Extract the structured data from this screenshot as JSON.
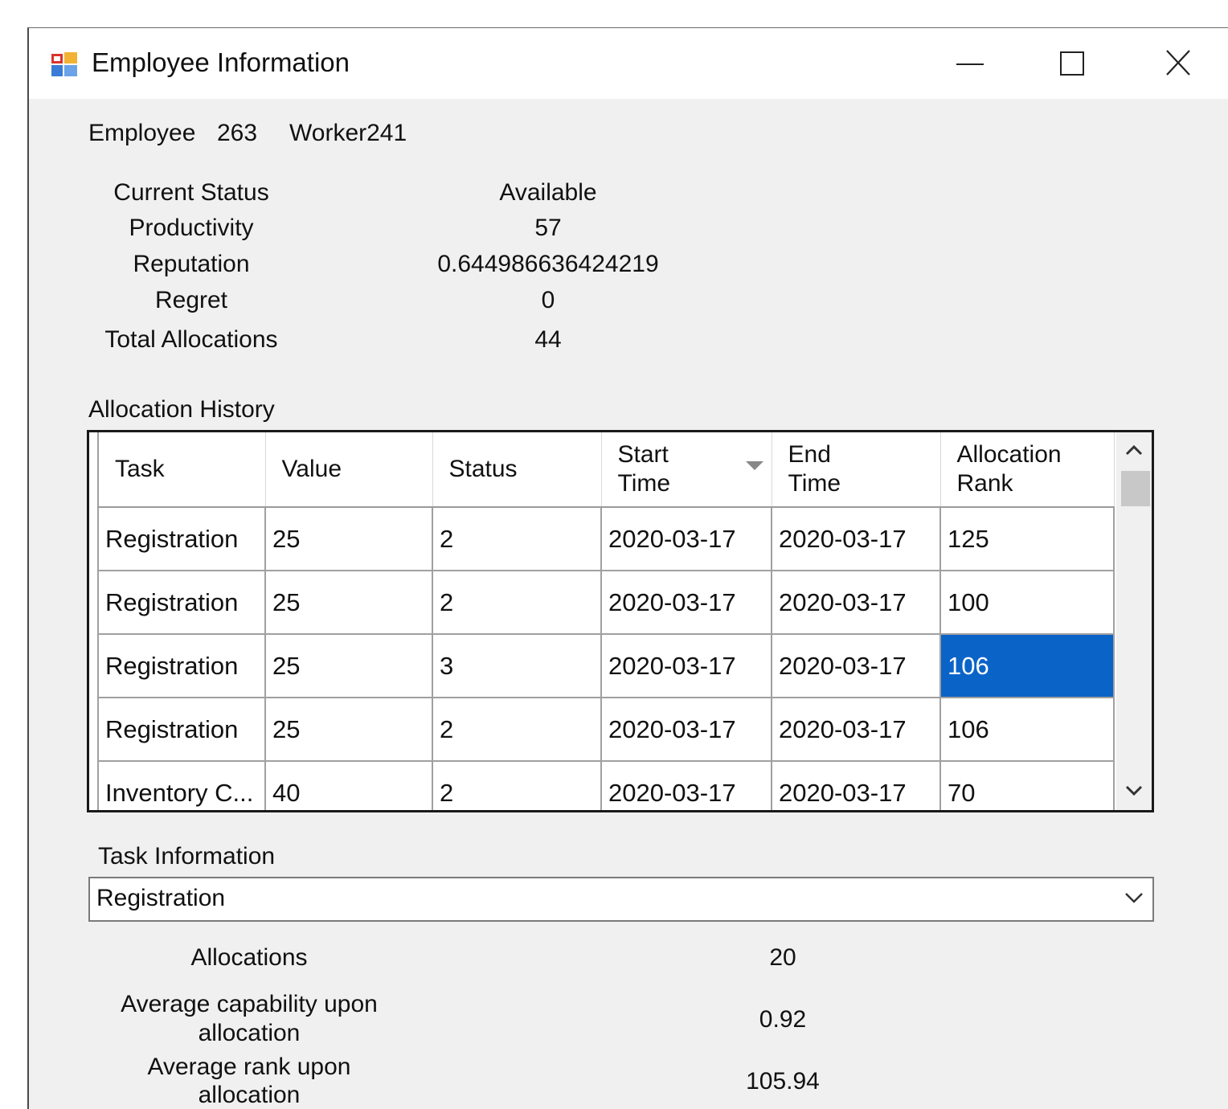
{
  "window": {
    "title": "Employee Information",
    "controls": [
      "minimize",
      "maximize",
      "close"
    ]
  },
  "employee": {
    "label": "Employee",
    "id": "263",
    "name": "Worker241"
  },
  "stats": {
    "current_status": {
      "label": "Current Status",
      "value": "Available"
    },
    "productivity": {
      "label": "Productivity",
      "value": "57"
    },
    "reputation": {
      "label": "Reputation",
      "value": "0.644986636424219"
    },
    "regret": {
      "label": "Regret",
      "value": "0"
    },
    "total_allocations": {
      "label": "Total Allocations",
      "value": "44"
    }
  },
  "allocation_history": {
    "label": "Allocation History",
    "columns": {
      "task": "Task",
      "value": "Value",
      "status": "Status",
      "start_time": "Start Time",
      "end_time": "End Time",
      "allocation_rank": "Allocation Rank"
    },
    "rows": [
      {
        "task": "Registration",
        "value": "25",
        "status": "2",
        "start": "2020-03-17",
        "end": "2020-03-17",
        "rank": "125"
      },
      {
        "task": "Registration",
        "value": "25",
        "status": "2",
        "start": "2020-03-17",
        "end": "2020-03-17",
        "rank": "100"
      },
      {
        "task": "Registration",
        "value": "25",
        "status": "3",
        "start": "2020-03-17",
        "end": "2020-03-17",
        "rank": "106"
      },
      {
        "task": "Registration",
        "value": "25",
        "status": "2",
        "start": "2020-03-17",
        "end": "2020-03-17",
        "rank": "106"
      },
      {
        "task": "Inventory C...",
        "value": "40",
        "status": "2",
        "start": "2020-03-17",
        "end": "2020-03-17",
        "rank": "70"
      }
    ],
    "selected_cell": "rows.2.rank"
  },
  "task_information": {
    "label": "Task Information",
    "selected_task": "Registration",
    "allocations": {
      "label": "Allocations",
      "value": "20"
    },
    "avg_capability": {
      "label_line1": "Average capability upon",
      "label_line2": "allocation",
      "value": "0.92"
    },
    "avg_rank": {
      "label_line1": "Average rank upon",
      "label_line2": "allocation",
      "value": "105.94"
    }
  },
  "colors": {
    "selection": "#0a64c8",
    "window_bg": "#f0f0f0"
  }
}
